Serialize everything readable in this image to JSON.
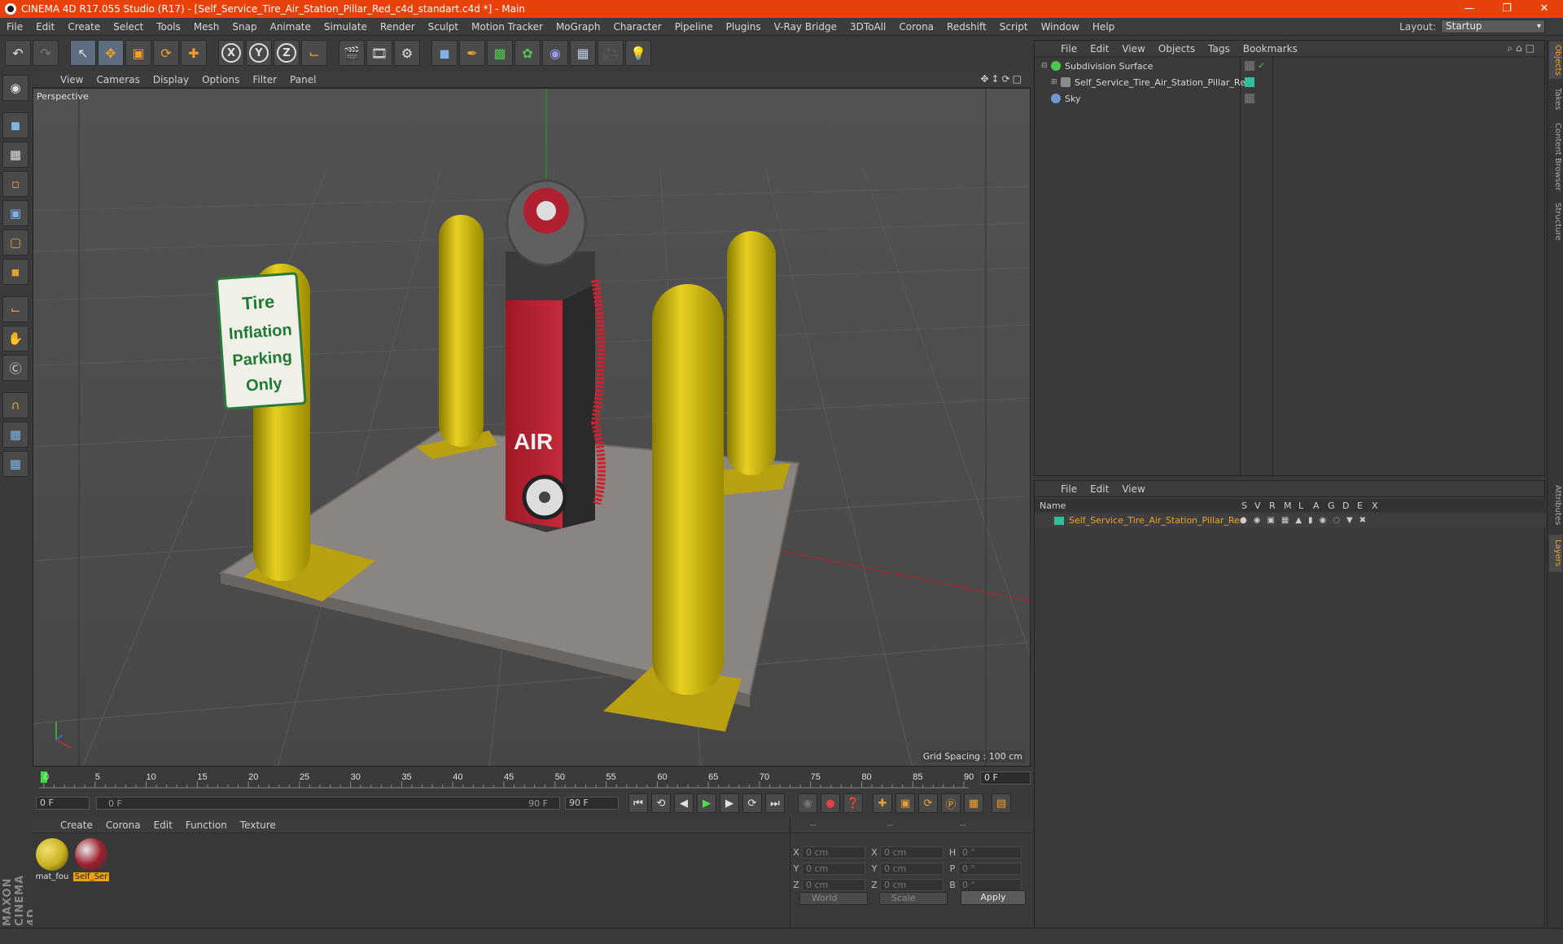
{
  "window": {
    "title": "CINEMA 4D R17.055 Studio (R17) - [Self_Service_Tire_Air_Station_Pillar_Red_c4d_standart.c4d *] - Main",
    "controls": [
      "—",
      "❐",
      "✕"
    ]
  },
  "menu": [
    "File",
    "Edit",
    "Create",
    "Select",
    "Tools",
    "Mesh",
    "Snap",
    "Animate",
    "Simulate",
    "Render",
    "Sculpt",
    "Motion Tracker",
    "MoGraph",
    "Character",
    "Pipeline",
    "Plugins",
    "V-Ray Bridge",
    "3DToAll",
    "Corona",
    "Redshift",
    "Script",
    "Window",
    "Help"
  ],
  "layout": {
    "label": "Layout:",
    "value": "Startup"
  },
  "viewport": {
    "menu": [
      "View",
      "Cameras",
      "Display",
      "Options",
      "Filter",
      "Panel"
    ],
    "label": "Perspective",
    "grid_spacing": "Grid Spacing : 100 cm",
    "sign_text": [
      "Tire",
      "Inflation",
      "Parking",
      "Only"
    ],
    "air_text": "AIR"
  },
  "timeline": {
    "ticks": [
      "0",
      "5",
      "10",
      "15",
      "20",
      "25",
      "30",
      "35",
      "40",
      "45",
      "50",
      "55",
      "60",
      "65",
      "70",
      "75",
      "80",
      "85",
      "90"
    ],
    "current_frame": "0 F"
  },
  "playbar": {
    "start": "0 F",
    "range_start": "0 F",
    "range_end": "90 F",
    "end": "90 F"
  },
  "materials": {
    "menu": [
      "Create",
      "Corona",
      "Edit",
      "Function",
      "Texture"
    ],
    "items": [
      {
        "name": "mat_fou",
        "color": "#c8b020"
      },
      {
        "name": "Self_Ser",
        "color": "#a02030"
      }
    ]
  },
  "coords": {
    "header": [
      "--",
      "--",
      "--"
    ],
    "rows": [
      {
        "a": "X",
        "av": "0 cm",
        "b": "X",
        "bv": "0 cm",
        "c": "H",
        "cv": "0 °"
      },
      {
        "a": "Y",
        "av": "0 cm",
        "b": "Y",
        "bv": "0 cm",
        "c": "P",
        "cv": "0 °"
      },
      {
        "a": "Z",
        "av": "0 cm",
        "b": "Z",
        "bv": "0 cm",
        "c": "B",
        "cv": "0 °"
      }
    ],
    "space": "World",
    "mode": "Scale",
    "apply": "Apply"
  },
  "object_manager": {
    "menu": [
      "File",
      "Edit",
      "View",
      "Objects",
      "Tags",
      "Bookmarks"
    ],
    "objects": [
      {
        "name": "Subdivision Surface",
        "indent": 0,
        "icon_color": "#4ec64e"
      },
      {
        "name": "Self_Service_Tire_Air_Station_Pillar_Red",
        "indent": 1,
        "icon_color": "#8a8a8a"
      },
      {
        "name": "Sky",
        "indent": 0,
        "icon_color": "#6a9ad0"
      }
    ]
  },
  "layer_manager": {
    "menu": [
      "File",
      "Edit",
      "View"
    ],
    "columns": [
      "Name",
      "S",
      "V",
      "R",
      "M",
      "L",
      "A",
      "G",
      "D",
      "E",
      "X"
    ],
    "layers": [
      {
        "name": "Self_Service_Tire_Air_Station_Pillar_Red",
        "color": "#2fbfa0"
      }
    ]
  },
  "right_tabs": [
    "Objects",
    "Takes",
    "Content Browser",
    "Structure",
    "Attributes",
    "Layers"
  ],
  "colors": {
    "titlebar": "#e8420a",
    "accent": "#f0a030"
  }
}
